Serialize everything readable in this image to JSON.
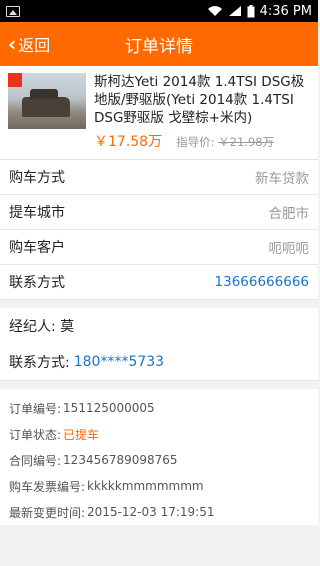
{
  "status_bar": {
    "time": "4:36 PM"
  },
  "nav": {
    "back_label": "返回",
    "title": "订单详情"
  },
  "product": {
    "name": "斯柯达Yeti 2014款 1.4TSI DSG极地版/野驱版(Yeti 2014款 1.4TSI DSG野驱版 戈壁棕+米内)",
    "price": "￥17.58万",
    "guide_label": "指导价: ",
    "guide_price": "￥21.98万"
  },
  "info_rows": [
    {
      "label": "购车方式",
      "value": "新车贷款"
    },
    {
      "label": "提车城市",
      "value": "合肥市"
    },
    {
      "label": "购车客户",
      "value": "呃呃呃"
    },
    {
      "label": "联系方式",
      "value": "13666666666"
    }
  ],
  "agent": {
    "label": "经纪人: 莫",
    "contact_label": "联系方式: ",
    "contact_phone": "180****5733"
  },
  "details": [
    {
      "label": "订单编号: ",
      "value": "151125000005"
    },
    {
      "label": "订单状态: ",
      "value": "已提车"
    },
    {
      "label": "合同编号: ",
      "value": "123456789098765"
    },
    {
      "label": "购车发票编号: ",
      "value": "kkkkkmmmmmmm"
    },
    {
      "label": "最新变更时间: ",
      "value": "2015-12-03 17:19:51"
    }
  ]
}
